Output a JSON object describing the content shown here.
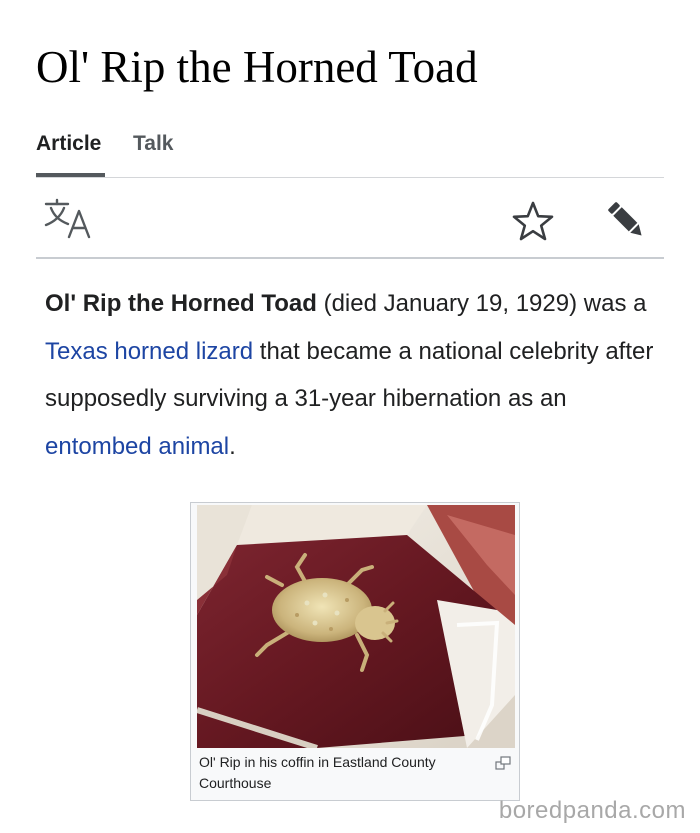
{
  "page": {
    "title": "Ol' Rip the Horned Toad"
  },
  "tabs": [
    {
      "label": "Article"
    },
    {
      "label": "Talk"
    }
  ],
  "toolbar": {
    "language_icon": "translate-icon",
    "watch_icon": "star-icon",
    "edit_icon": "pencil-icon"
  },
  "lead": {
    "subject": "Ol' Rip the Horned Toad",
    "text_1": " (died January 19, 1929) was a ",
    "link_1": "Texas horned lizard",
    "text_2": " that became a national celebrity after supposedly surviving a 31-year hibernation as an ",
    "link_2": "entombed animal",
    "text_3": "."
  },
  "figure": {
    "caption": "Ol' Rip in his coffin in Eastland County Courthouse",
    "expand_icon": "expand-icon"
  },
  "watermark": "boredpanda.com",
  "colors": {
    "link": "#1d45a3",
    "text": "#202122",
    "tab_muted": "#54595d",
    "velvet": "#6e1a22"
  }
}
